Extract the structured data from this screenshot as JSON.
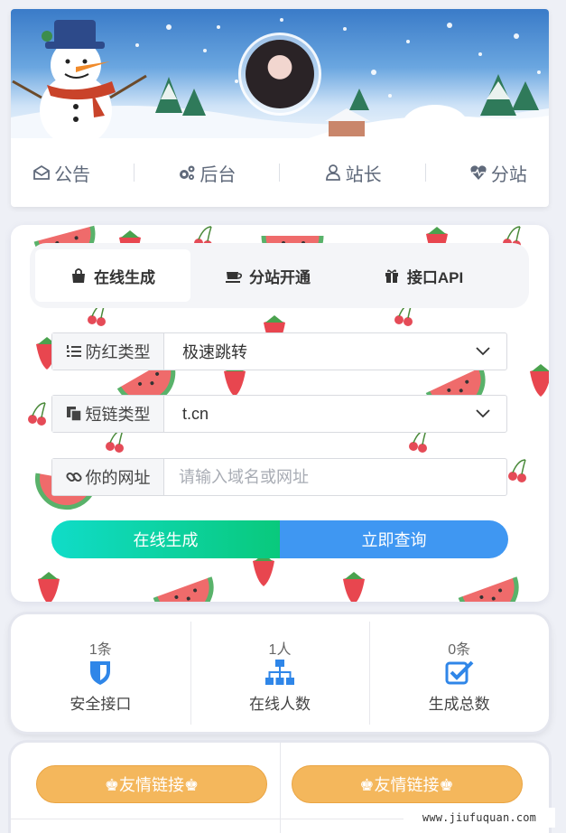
{
  "nav": [
    {
      "label": "公告",
      "icon": "envelope-open-icon"
    },
    {
      "label": "后台",
      "icon": "gears-icon"
    },
    {
      "label": "站长",
      "icon": "user-icon"
    },
    {
      "label": "分站",
      "icon": "heartbeat-icon"
    }
  ],
  "tabs": [
    {
      "label": "在线生成",
      "icon": "shopping-bag-icon",
      "active": true
    },
    {
      "label": "分站开通",
      "icon": "coffee-cup-icon",
      "active": false
    },
    {
      "label": "接口API",
      "icon": "gift-icon",
      "active": false
    }
  ],
  "form": {
    "antired_label": "防红类型",
    "antired_value": "极速跳转",
    "shortlink_label": "短链类型",
    "shortlink_value": "t.cn",
    "url_label": "你的网址",
    "url_placeholder": "请输入域名或网址"
  },
  "buttons": {
    "generate": "在线生成",
    "query": "立即查询"
  },
  "stats": [
    {
      "value": "1条",
      "label": "安全接口",
      "icon": "shield-icon"
    },
    {
      "value": "1人",
      "label": "在线人数",
      "icon": "sitemap-icon"
    },
    {
      "value": "0条",
      "label": "生成总数",
      "icon": "check-square-icon"
    }
  ],
  "links": [
    {
      "label": "♚友情链接♚"
    },
    {
      "label": "♚友情链接♚"
    }
  ],
  "watermark": "www.jiufuquan.com",
  "colors": {
    "generate_gradient": [
      "#10dcc8",
      "#09c97c"
    ],
    "query": "#3f97f2",
    "friend_link": "#f4b75c",
    "stat_icon": "#2f86e8"
  }
}
